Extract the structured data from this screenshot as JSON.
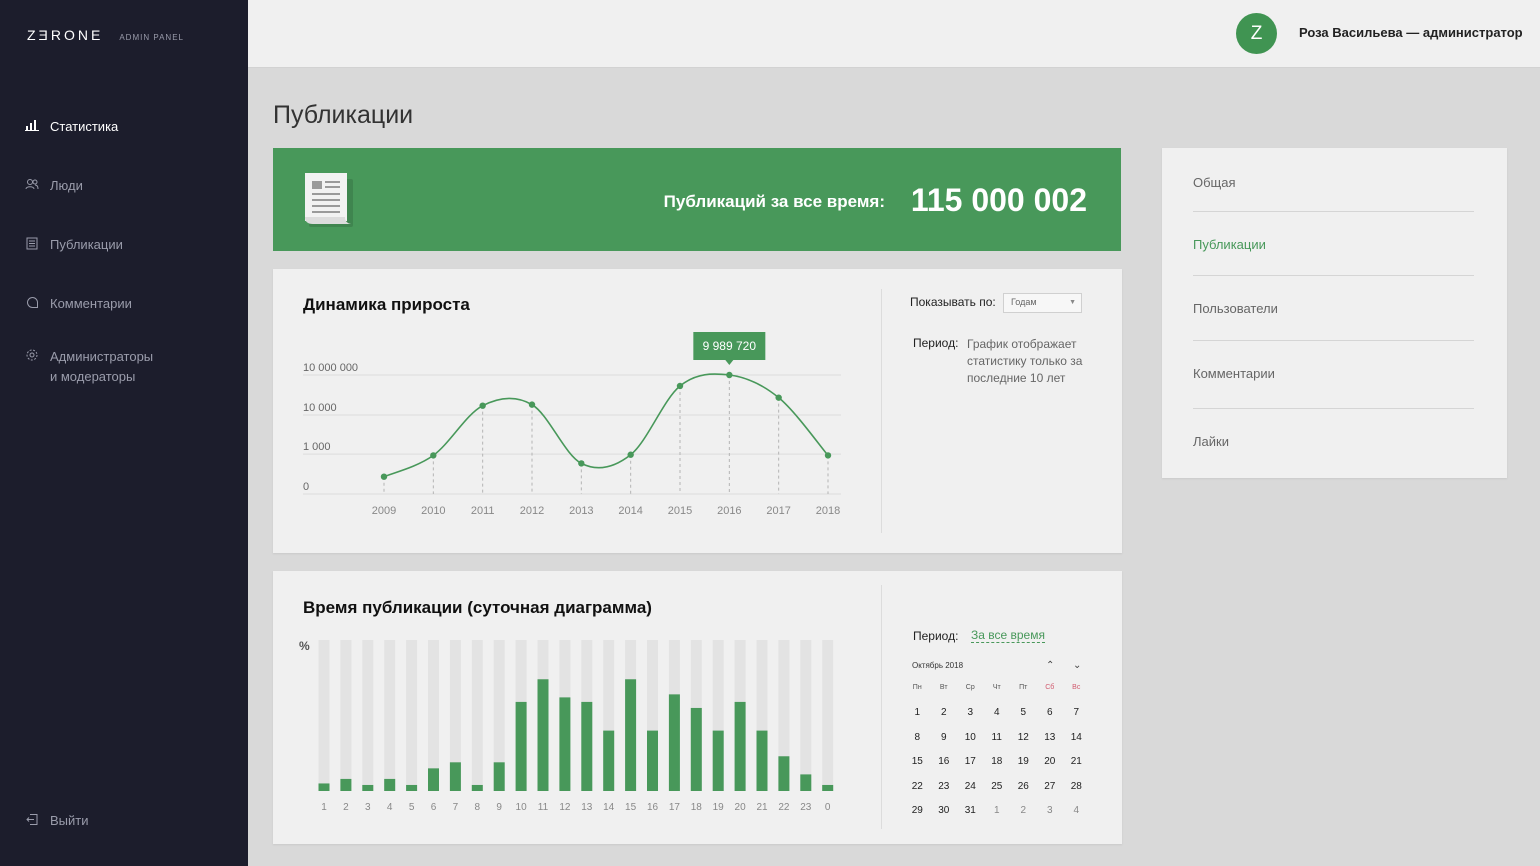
{
  "brand": {
    "logo": "ZƎRONE",
    "subtitle": "ADMIN PANEL"
  },
  "sidebar": {
    "items": [
      {
        "label": "Статистика",
        "icon": "bar-chart-icon",
        "active": true
      },
      {
        "label": "Люди",
        "icon": "people-icon",
        "active": false
      },
      {
        "label": "Публикации",
        "icon": "document-icon",
        "active": false
      },
      {
        "label": "Комментарии",
        "icon": "comment-icon",
        "active": false
      },
      {
        "label": "Администраторы\nи модераторы",
        "icon": "gear-icon",
        "active": false
      }
    ],
    "logout": "Выйти"
  },
  "header": {
    "avatar_letter": "Z",
    "user": "Роза Васильева — администратор"
  },
  "page_title": "Публикации",
  "banner": {
    "label": "Публикаций за все время:",
    "value": "115 000 002"
  },
  "growth": {
    "title": "Динамика прироста",
    "show_by_label": "Показывать по:",
    "show_by_value": "Годам",
    "period_label": "Период:",
    "period_text": "График отображает статистику только за последние 10 лет"
  },
  "daily": {
    "title": "Время публикации (суточная диаграмма)",
    "period_label": "Период:",
    "period_value": "За все время",
    "calendar": {
      "month": "Октябрь 2018",
      "weekdays": [
        "Пн",
        "Вт",
        "Ср",
        "Чт",
        "Пт",
        "Сб",
        "Вс"
      ],
      "days": [
        "1",
        "2",
        "3",
        "4",
        "5",
        "6",
        "7",
        "8",
        "9",
        "10",
        "11",
        "12",
        "13",
        "14",
        "15",
        "16",
        "17",
        "18",
        "19",
        "20",
        "21",
        "22",
        "23",
        "24",
        "25",
        "26",
        "27",
        "28",
        "29",
        "30",
        "31",
        "1",
        "2",
        "3",
        "4"
      ]
    }
  },
  "tabs": [
    {
      "label": "Общая",
      "active": false
    },
    {
      "label": "Публикации",
      "active": true
    },
    {
      "label": "Пользователи",
      "active": false
    },
    {
      "label": "Комментарии",
      "active": false
    },
    {
      "label": "Лайки",
      "active": false
    }
  ],
  "colors": {
    "accent": "#48985a",
    "sidebar": "#1c1d2c",
    "background": "#d9d9d9"
  },
  "chart_data": [
    {
      "type": "line",
      "title": "Динамика прироста",
      "y_scale": "log",
      "y_ticks": [
        "0",
        "1 000",
        "10 000",
        "10 000 000"
      ],
      "x": [
        "2009",
        "2010",
        "2011",
        "2012",
        "2013",
        "2014",
        "2015",
        "2016",
        "2017",
        "2018"
      ],
      "values": [
        20,
        800,
        50000,
        60000,
        200,
        900,
        1500000,
        9989720,
        200000,
        800
      ],
      "tooltip": {
        "x": "2016",
        "label": "9 989 720"
      }
    },
    {
      "type": "bar",
      "title": "Время публикации (суточная диаграмма)",
      "ylabel": "%",
      "categories": [
        "1",
        "2",
        "3",
        "4",
        "5",
        "6",
        "7",
        "8",
        "9",
        "10",
        "11",
        "12",
        "13",
        "14",
        "15",
        "16",
        "17",
        "18",
        "19",
        "20",
        "21",
        "22",
        "23",
        "0"
      ],
      "values": [
        5,
        8,
        4,
        8,
        4,
        15,
        19,
        4,
        19,
        59,
        74,
        62,
        59,
        40,
        74,
        40,
        64,
        55,
        40,
        59,
        40,
        23,
        11,
        4
      ],
      "ylim": [
        0,
        100
      ]
    }
  ]
}
